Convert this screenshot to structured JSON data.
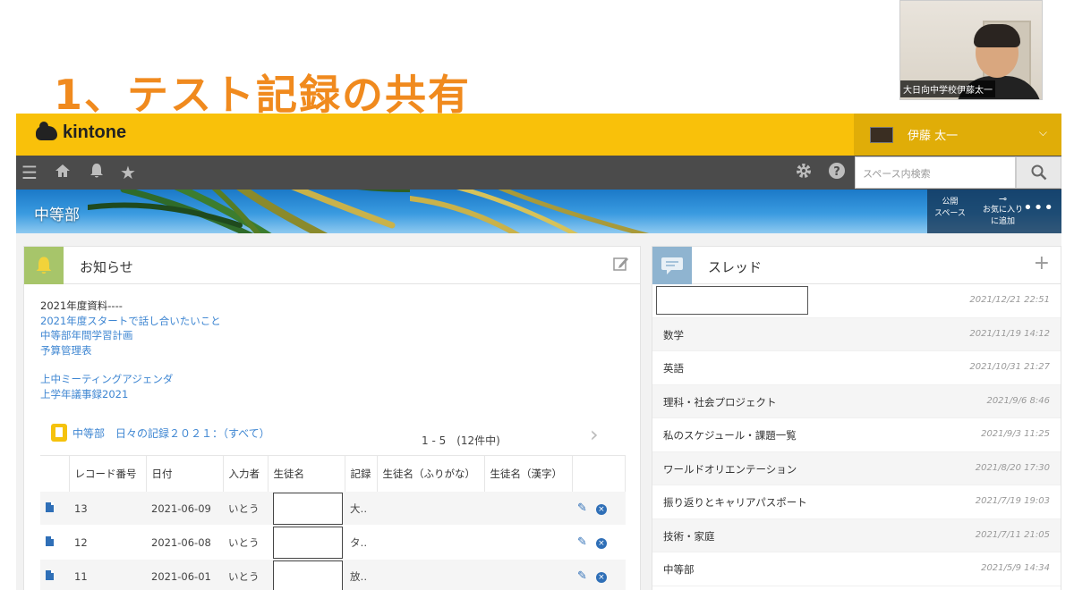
{
  "slide": {
    "title": "1、テスト記録の共有"
  },
  "webcam": {
    "name": "大日向中学校伊藤太一"
  },
  "app": {
    "logo": "kintone",
    "user": {
      "name": "伊藤 太一"
    }
  },
  "nav": {
    "search_placeholder": "スペース内検索"
  },
  "space": {
    "title": "中等部",
    "public_label_1": "公開",
    "public_label_2": "スペース",
    "favorite_label_1": "お気に入り",
    "favorite_label_2": "に追加"
  },
  "notice": {
    "title": "お知らせ",
    "heading": "2021年度資料----",
    "links": [
      "2021年度スタートで話し合いたいこと",
      "中等部年間学習計画",
      "予算管理表"
    ],
    "links2": [
      "上中ミーティングアジェンダ",
      "上学年議事録2021"
    ],
    "records_title": "中等部　日々の記録２０２１：（すべて）",
    "pager": "1 - 5　(12件中)",
    "columns": [
      "",
      "レコード番号",
      "日付",
      "入力者",
      "生徒名",
      "記録",
      "生徒名（ふりがな）",
      "生徒名（漢字）",
      ""
    ],
    "rows": [
      {
        "id": "13",
        "date": "2021-06-09",
        "author": "いとう",
        "record": "大‥"
      },
      {
        "id": "12",
        "date": "2021-06-08",
        "author": "いとう",
        "record": "タ‥"
      },
      {
        "id": "11",
        "date": "2021-06-01",
        "author": "いとう",
        "record": "放‥"
      }
    ]
  },
  "threads": {
    "title": "スレッド",
    "items": [
      {
        "name": "",
        "date": "2021/12/21 22:51"
      },
      {
        "name": "数学",
        "date": "2021/11/19 14:12"
      },
      {
        "name": "英語",
        "date": "2021/10/31 21:27"
      },
      {
        "name": "理科・社会プロジェクト",
        "date": "2021/9/6 8:46"
      },
      {
        "name": "私のスケジュール・課題一覧",
        "date": "2021/9/3 11:25"
      },
      {
        "name": "ワールドオリエンテーション",
        "date": "2021/8/20 17:30"
      },
      {
        "name": "振り返りとキャリアパスポート",
        "date": "2021/7/19 19:03"
      },
      {
        "name": "技術・家庭",
        "date": "2021/7/11 21:05"
      },
      {
        "name": "中等部",
        "date": "2021/5/9 14:34"
      }
    ]
  },
  "colors": {
    "brand_yellow": "#f9c10a",
    "title_orange": "#f08a1e",
    "link_blue": "#3e86d2"
  }
}
